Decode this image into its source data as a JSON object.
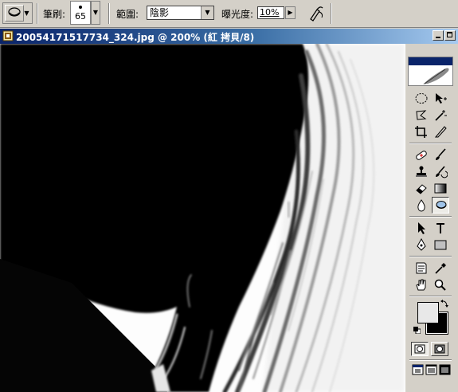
{
  "options_bar": {
    "brush_label": "筆刷:",
    "brush_size": "65",
    "range_label": "範圍:",
    "range_value": "陰影",
    "exposure_label": "曝光度:",
    "exposure_value": "10%"
  },
  "document": {
    "title": "20054171517734_324.jpg @ 200% (紅 拷貝/8)"
  },
  "toolbox": {
    "active_tool": "dodge-tool"
  },
  "colors": {
    "foreground": "#e8e8e8",
    "background": "#000000",
    "titlebar_start": "#0a246a",
    "titlebar_end": "#a6caf0"
  }
}
